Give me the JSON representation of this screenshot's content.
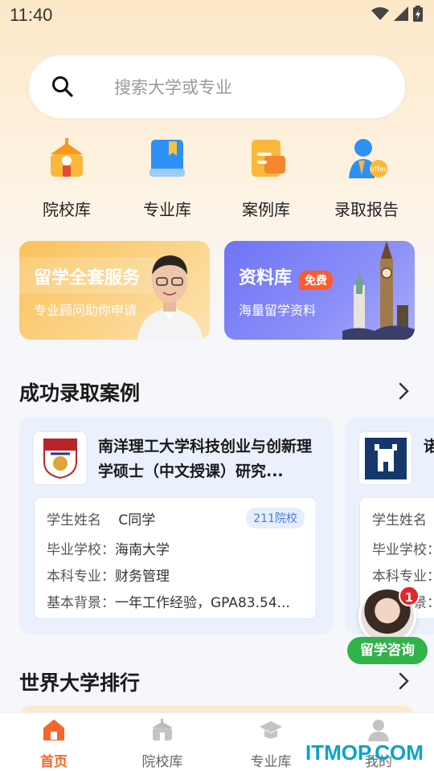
{
  "status_bar": {
    "time": "11:40"
  },
  "search": {
    "placeholder": "搜索大学或专业"
  },
  "quick_actions": [
    {
      "label": "院校库",
      "icon": "school-building-icon"
    },
    {
      "label": "专业库",
      "icon": "book-icon"
    },
    {
      "label": "案例库",
      "icon": "folder-icon"
    },
    {
      "label": "录取报告",
      "icon": "offer-person-icon"
    }
  ],
  "banners": [
    {
      "title": "留学全套服务",
      "subtitle": "专业顾问助你申请"
    },
    {
      "title": "资料库",
      "badge": "免费",
      "subtitle": "海量留学资料"
    }
  ],
  "success_cases": {
    "title": "成功录取案例",
    "cards": [
      {
        "program": "南洋理工大学科技创业与创新理学硕士（中文授课）研究...",
        "tag": "211院校",
        "rows": [
          {
            "key": "学生姓名",
            "value": "C同学"
          },
          {
            "key": "毕业学校：",
            "value": "海南大学"
          },
          {
            "key": "本科专业：",
            "value": "财务管理"
          },
          {
            "key": "基本背景：",
            "value": "一年工作经验，GPA83.54..."
          }
        ]
      },
      {
        "program": "诺",
        "rows": [
          {
            "key": "学生姓名",
            "value": ""
          },
          {
            "key": "毕业学校：",
            "value": ""
          },
          {
            "key": "本科专业：",
            "value": ""
          },
          {
            "key": "基本背景：",
            "value": ""
          }
        ]
      }
    ]
  },
  "consult": {
    "badge": "1",
    "label": "留学咨询"
  },
  "ranking": {
    "title": "世界大学排行"
  },
  "tabbar": [
    {
      "label": "首页",
      "active": true
    },
    {
      "label": "院校库",
      "active": false
    },
    {
      "label": "专业库",
      "active": false
    },
    {
      "label": "我的",
      "active": false
    }
  ],
  "watermark": "ITMOP.COM",
  "colors": {
    "accent": "#f5662b",
    "consult_green": "#32b24a",
    "tag_blue": "#4a7bd3"
  }
}
